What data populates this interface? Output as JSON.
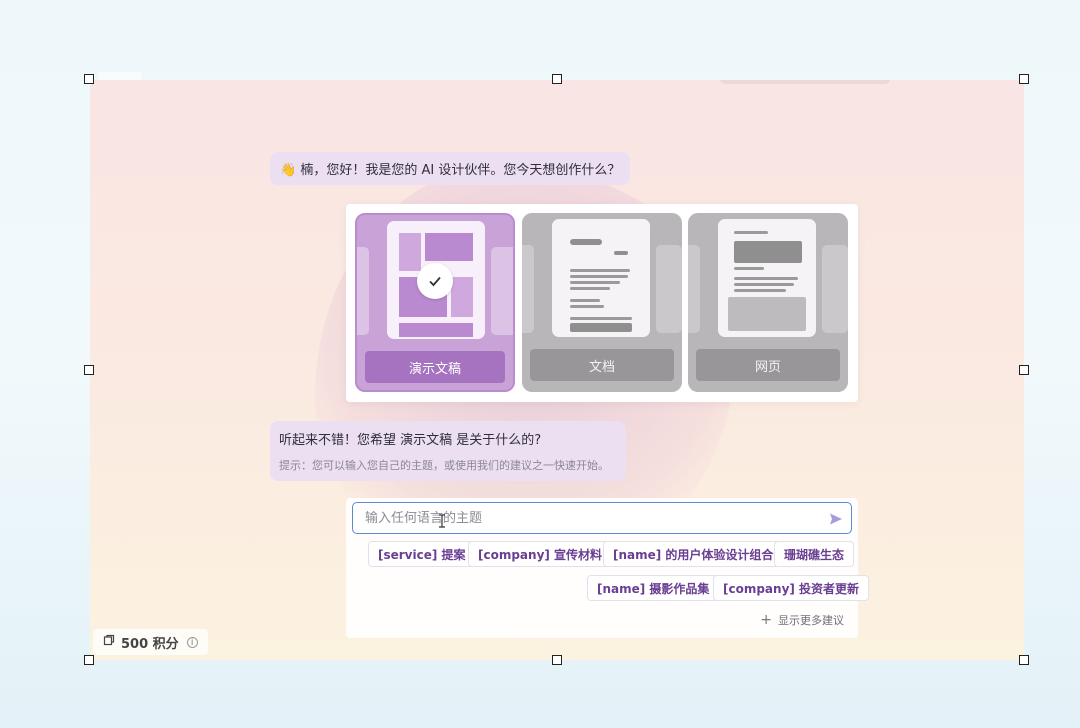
{
  "greeting": {
    "emoji": "👋",
    "text": "楠，您好！我是您的 AI 设计伙伴。您今天想创作什么？"
  },
  "type_cards": [
    {
      "label": "演示文稿",
      "selected": true
    },
    {
      "label": "文档",
      "selected": false
    },
    {
      "label": "网页",
      "selected": false
    }
  ],
  "prompt": {
    "question": "听起来不错！您希望 演示文稿 是关于什么的?",
    "hint": "提示：您可以输入您自己的主题，或使用我们的建议之一快速开始。"
  },
  "input": {
    "placeholder": "输入任何语言的主题",
    "value": ""
  },
  "suggestions": [
    "[service] 提案",
    "[company] 宣传材料",
    "[name] 的用户体验设计组合",
    "珊瑚礁生态",
    "[name] 摄影作品集",
    "[company] 投资者更新"
  ],
  "show_more": "显示更多建议",
  "credits": {
    "text": "500 积分"
  },
  "colors": {
    "accent": "#a673c0",
    "input_border": "#5a8bd0",
    "chip_text": "#6a3e92"
  }
}
